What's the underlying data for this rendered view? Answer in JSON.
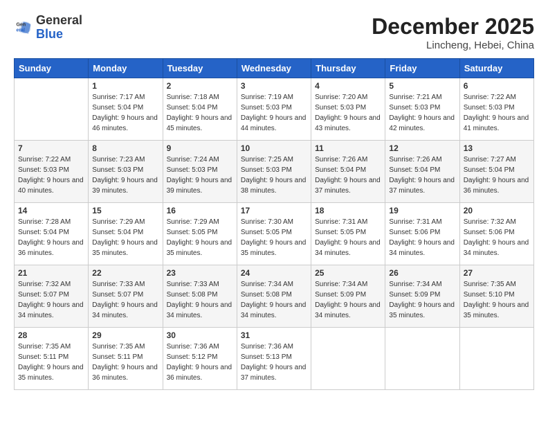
{
  "header": {
    "logo_general": "General",
    "logo_blue": "Blue",
    "month": "December 2025",
    "location": "Lincheng, Hebei, China"
  },
  "weekdays": [
    "Sunday",
    "Monday",
    "Tuesday",
    "Wednesday",
    "Thursday",
    "Friday",
    "Saturday"
  ],
  "weeks": [
    [
      {
        "day": "",
        "sunrise": "",
        "sunset": "",
        "daylight": ""
      },
      {
        "day": "1",
        "sunrise": "7:17 AM",
        "sunset": "5:04 PM",
        "daylight": "9 hours and 46 minutes."
      },
      {
        "day": "2",
        "sunrise": "7:18 AM",
        "sunset": "5:04 PM",
        "daylight": "9 hours and 45 minutes."
      },
      {
        "day": "3",
        "sunrise": "7:19 AM",
        "sunset": "5:03 PM",
        "daylight": "9 hours and 44 minutes."
      },
      {
        "day": "4",
        "sunrise": "7:20 AM",
        "sunset": "5:03 PM",
        "daylight": "9 hours and 43 minutes."
      },
      {
        "day": "5",
        "sunrise": "7:21 AM",
        "sunset": "5:03 PM",
        "daylight": "9 hours and 42 minutes."
      },
      {
        "day": "6",
        "sunrise": "7:22 AM",
        "sunset": "5:03 PM",
        "daylight": "9 hours and 41 minutes."
      }
    ],
    [
      {
        "day": "7",
        "sunrise": "7:22 AM",
        "sunset": "5:03 PM",
        "daylight": "9 hours and 40 minutes."
      },
      {
        "day": "8",
        "sunrise": "7:23 AM",
        "sunset": "5:03 PM",
        "daylight": "9 hours and 39 minutes."
      },
      {
        "day": "9",
        "sunrise": "7:24 AM",
        "sunset": "5:03 PM",
        "daylight": "9 hours and 39 minutes."
      },
      {
        "day": "10",
        "sunrise": "7:25 AM",
        "sunset": "5:03 PM",
        "daylight": "9 hours and 38 minutes."
      },
      {
        "day": "11",
        "sunrise": "7:26 AM",
        "sunset": "5:04 PM",
        "daylight": "9 hours and 37 minutes."
      },
      {
        "day": "12",
        "sunrise": "7:26 AM",
        "sunset": "5:04 PM",
        "daylight": "9 hours and 37 minutes."
      },
      {
        "day": "13",
        "sunrise": "7:27 AM",
        "sunset": "5:04 PM",
        "daylight": "9 hours and 36 minutes."
      }
    ],
    [
      {
        "day": "14",
        "sunrise": "7:28 AM",
        "sunset": "5:04 PM",
        "daylight": "9 hours and 36 minutes."
      },
      {
        "day": "15",
        "sunrise": "7:29 AM",
        "sunset": "5:04 PM",
        "daylight": "9 hours and 35 minutes."
      },
      {
        "day": "16",
        "sunrise": "7:29 AM",
        "sunset": "5:05 PM",
        "daylight": "9 hours and 35 minutes."
      },
      {
        "day": "17",
        "sunrise": "7:30 AM",
        "sunset": "5:05 PM",
        "daylight": "9 hours and 35 minutes."
      },
      {
        "day": "18",
        "sunrise": "7:31 AM",
        "sunset": "5:05 PM",
        "daylight": "9 hours and 34 minutes."
      },
      {
        "day": "19",
        "sunrise": "7:31 AM",
        "sunset": "5:06 PM",
        "daylight": "9 hours and 34 minutes."
      },
      {
        "day": "20",
        "sunrise": "7:32 AM",
        "sunset": "5:06 PM",
        "daylight": "9 hours and 34 minutes."
      }
    ],
    [
      {
        "day": "21",
        "sunrise": "7:32 AM",
        "sunset": "5:07 PM",
        "daylight": "9 hours and 34 minutes."
      },
      {
        "day": "22",
        "sunrise": "7:33 AM",
        "sunset": "5:07 PM",
        "daylight": "9 hours and 34 minutes."
      },
      {
        "day": "23",
        "sunrise": "7:33 AM",
        "sunset": "5:08 PM",
        "daylight": "9 hours and 34 minutes."
      },
      {
        "day": "24",
        "sunrise": "7:34 AM",
        "sunset": "5:08 PM",
        "daylight": "9 hours and 34 minutes."
      },
      {
        "day": "25",
        "sunrise": "7:34 AM",
        "sunset": "5:09 PM",
        "daylight": "9 hours and 34 minutes."
      },
      {
        "day": "26",
        "sunrise": "7:34 AM",
        "sunset": "5:09 PM",
        "daylight": "9 hours and 35 minutes."
      },
      {
        "day": "27",
        "sunrise": "7:35 AM",
        "sunset": "5:10 PM",
        "daylight": "9 hours and 35 minutes."
      }
    ],
    [
      {
        "day": "28",
        "sunrise": "7:35 AM",
        "sunset": "5:11 PM",
        "daylight": "9 hours and 35 minutes."
      },
      {
        "day": "29",
        "sunrise": "7:35 AM",
        "sunset": "5:11 PM",
        "daylight": "9 hours and 36 minutes."
      },
      {
        "day": "30",
        "sunrise": "7:36 AM",
        "sunset": "5:12 PM",
        "daylight": "9 hours and 36 minutes."
      },
      {
        "day": "31",
        "sunrise": "7:36 AM",
        "sunset": "5:13 PM",
        "daylight": "9 hours and 37 minutes."
      },
      {
        "day": "",
        "sunrise": "",
        "sunset": "",
        "daylight": ""
      },
      {
        "day": "",
        "sunrise": "",
        "sunset": "",
        "daylight": ""
      },
      {
        "day": "",
        "sunrise": "",
        "sunset": "",
        "daylight": ""
      }
    ]
  ]
}
